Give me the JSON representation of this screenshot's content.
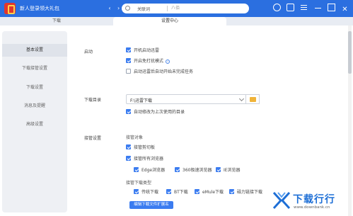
{
  "titlebar": {
    "app_title": "新人登录领大礼包",
    "nav_back": "‹",
    "nav_forward": "›",
    "search_scope": "关联词",
    "search_placeholder": "八佰"
  },
  "tabs": [
    {
      "label": "下载"
    },
    {
      "label": "设置中心"
    }
  ],
  "sidebar": {
    "items": [
      {
        "label": "基本设置",
        "active": true
      },
      {
        "label": "下载接管设置",
        "active": false
      },
      {
        "label": "下载设置",
        "active": false
      },
      {
        "label": "消息及提醒",
        "active": false
      },
      {
        "label": "高级设置",
        "active": false
      }
    ]
  },
  "startup": {
    "label": "启动",
    "options": [
      {
        "label": "开机启动迅雷",
        "checked": true
      },
      {
        "label": "开启免打扰模式",
        "checked": true
      },
      {
        "label": "启动迅雷后自动开始未完成任务",
        "checked": false
      }
    ]
  },
  "download_dir": {
    "label": "下载目录",
    "path": "F:\\迅雷下载",
    "auto_modify_label": "自动修改为上次使用的目录",
    "auto_modify_checked": true
  },
  "takeover": {
    "label": "接管设置",
    "objects_heading": "接管对象",
    "clipboard_label": "接管剪切板",
    "all_browsers_label": "接管所有浏览器",
    "browsers": [
      {
        "label": "Edge浏览器",
        "checked": true
      },
      {
        "label": "360极速浏览器",
        "checked": true
      },
      {
        "label": "IE浏览器",
        "checked": true
      }
    ],
    "types_heading": "接管下载类型",
    "types": [
      {
        "label": "传统下载",
        "checked": true
      },
      {
        "label": "BT下载",
        "checked": true
      },
      {
        "label": "eMule下载",
        "checked": true
      },
      {
        "label": "磁力链接下载",
        "checked": true
      }
    ],
    "edit_ext_button": "编辑下载文件扩展名"
  },
  "watermark": {
    "title": "下载行行",
    "url": "www.downbank.cn"
  },
  "colors": {
    "titlebar": "#2b6fe0",
    "accent": "#3b7cf0",
    "watermark": "#1e6fd6"
  }
}
